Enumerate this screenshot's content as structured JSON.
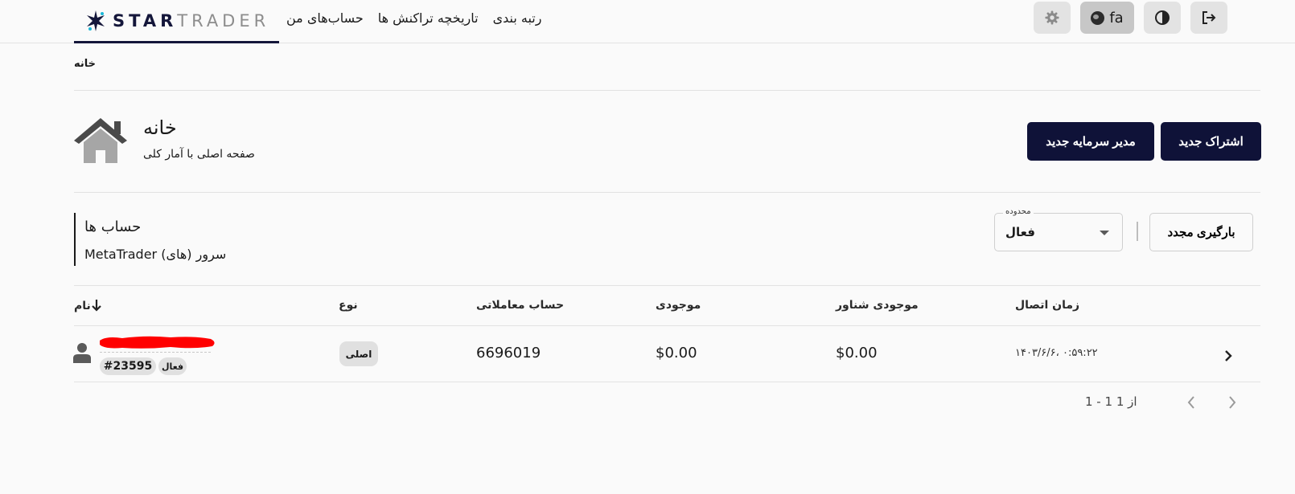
{
  "app": {
    "logo_strong": "STAR",
    "logo_thin": "TRADER"
  },
  "nav": {
    "items": [
      "رتبه بندی",
      "تاریخچه تراکنش ها",
      "حساب‌های من"
    ]
  },
  "topbar": {
    "lang_label": "fa",
    "icons": [
      "gear-icon",
      "globe-icon",
      "contrast-icon",
      "logout-icon"
    ]
  },
  "breadcrumb": "خانه",
  "page": {
    "title": "خانه",
    "subtitle": "صفحه اصلی با آمار کلی",
    "icon": "house-icon",
    "new_subscription_label": "اشتراک جدید",
    "new_manager_label": "مدیر سرمایه جدید"
  },
  "accounts": {
    "title": "حساب ها",
    "subtitle": "MetaTrader سرور (های)",
    "reload_label": "بارگیری مجدد",
    "filter_legend": "محدوده",
    "filter_value": "فعال"
  },
  "table": {
    "headers": {
      "name": "نام",
      "type": "نوع",
      "trading_account": "حساب معاملاتی",
      "balance": "موجودی",
      "floating_balance": "موجودی شناور",
      "connection_time": "زمان اتصال"
    },
    "rows": [
      {
        "id": "#23595",
        "status": "فعال",
        "type": "اصلی",
        "trading_account": "6696019",
        "balance": "$0.00",
        "floating_balance": "$0.00",
        "connection_time": "۱۴۰۳/۶/۶، ۰:۵۹:۲۲"
      }
    ]
  },
  "pagination": {
    "label": "1 - 1 از 1"
  },
  "colors": {
    "primary": "#0f1238",
    "accent_redaction": "#ff0000",
    "logo_cyan": "#1ab8d9"
  }
}
